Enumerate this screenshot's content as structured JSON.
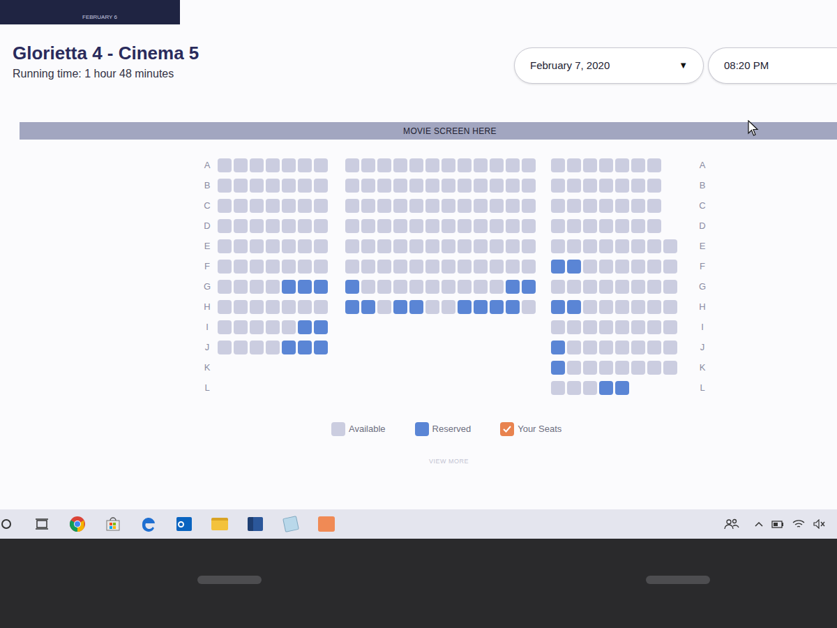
{
  "banner": {
    "text": "FEBRUARY 6"
  },
  "cinema": {
    "title": "Glorietta 4 - Cinema 5",
    "running_time": "Running time: 1 hour 48 minutes"
  },
  "date_select": {
    "value": "February 7, 2020",
    "arrow": "▼"
  },
  "time_select": {
    "value": "08:20 PM"
  },
  "screen_label": "MOVIE SCREEN HERE",
  "seat_map": {
    "rows": [
      {
        "label_left": "A",
        "label_right": "A",
        "left": [
          {
            "reserved": false
          },
          {
            "reserved": false
          },
          {
            "reserved": false
          },
          {
            "reserved": false
          },
          {
            "reserved": false
          },
          {
            "reserved": false
          },
          {
            "reserved": false
          }
        ],
        "middle": [
          {
            "reserved": false
          },
          {
            "reserved": false
          },
          {
            "reserved": false
          },
          {
            "reserved": false
          },
          {
            "reserved": false
          },
          {
            "reserved": false
          },
          {
            "reserved": false
          },
          {
            "reserved": false
          },
          {
            "reserved": false
          },
          {
            "reserved": false
          },
          {
            "reserved": false
          },
          {
            "reserved": false
          }
        ],
        "right": [
          {
            "reserved": false
          },
          {
            "reserved": false
          },
          {
            "reserved": false
          },
          {
            "reserved": false
          },
          {
            "reserved": false
          },
          {
            "reserved": false
          },
          {
            "reserved": false
          }
        ]
      },
      {
        "label_left": "B",
        "label_right": "B",
        "left": [
          {
            "reserved": false
          },
          {
            "reserved": false
          },
          {
            "reserved": false
          },
          {
            "reserved": false
          },
          {
            "reserved": false
          },
          {
            "reserved": false
          },
          {
            "reserved": false
          }
        ],
        "middle": [
          {
            "reserved": false
          },
          {
            "reserved": false
          },
          {
            "reserved": false
          },
          {
            "reserved": false
          },
          {
            "reserved": false
          },
          {
            "reserved": false
          },
          {
            "reserved": false
          },
          {
            "reserved": false
          },
          {
            "reserved": false
          },
          {
            "reserved": false
          },
          {
            "reserved": false
          },
          {
            "reserved": false
          }
        ],
        "right": [
          {
            "reserved": false
          },
          {
            "reserved": false
          },
          {
            "reserved": false
          },
          {
            "reserved": false
          },
          {
            "reserved": false
          },
          {
            "reserved": false
          },
          {
            "reserved": false
          }
        ]
      },
      {
        "label_left": "C",
        "label_right": "C",
        "left": [
          {
            "reserved": false
          },
          {
            "reserved": false
          },
          {
            "reserved": false
          },
          {
            "reserved": false
          },
          {
            "reserved": false
          },
          {
            "reserved": false
          },
          {
            "reserved": false
          }
        ],
        "middle": [
          {
            "reserved": false
          },
          {
            "reserved": false
          },
          {
            "reserved": false
          },
          {
            "reserved": false
          },
          {
            "reserved": false
          },
          {
            "reserved": false
          },
          {
            "reserved": false
          },
          {
            "reserved": false
          },
          {
            "reserved": false
          },
          {
            "reserved": false
          },
          {
            "reserved": false
          },
          {
            "reserved": false
          }
        ],
        "right": [
          {
            "reserved": false
          },
          {
            "reserved": false
          },
          {
            "reserved": false
          },
          {
            "reserved": false
          },
          {
            "reserved": false
          },
          {
            "reserved": false
          },
          {
            "reserved": false
          }
        ]
      },
      {
        "label_left": "D",
        "label_right": "D",
        "left": [
          {
            "reserved": false
          },
          {
            "reserved": false
          },
          {
            "reserved": false
          },
          {
            "reserved": false
          },
          {
            "reserved": false
          },
          {
            "reserved": false
          },
          {
            "reserved": false
          }
        ],
        "middle": [
          {
            "reserved": false
          },
          {
            "reserved": false
          },
          {
            "reserved": false
          },
          {
            "reserved": false
          },
          {
            "reserved": false
          },
          {
            "reserved": false
          },
          {
            "reserved": false
          },
          {
            "reserved": false
          },
          {
            "reserved": false
          },
          {
            "reserved": false
          },
          {
            "reserved": false
          },
          {
            "reserved": false
          }
        ],
        "right": [
          {
            "reserved": false
          },
          {
            "reserved": false
          },
          {
            "reserved": false
          },
          {
            "reserved": false
          },
          {
            "reserved": false
          },
          {
            "reserved": false
          },
          {
            "reserved": false
          }
        ]
      },
      {
        "label_left": "E",
        "label_right": "E",
        "left": [
          {
            "reserved": false
          },
          {
            "reserved": false
          },
          {
            "reserved": false
          },
          {
            "reserved": false
          },
          {
            "reserved": false
          },
          {
            "reserved": false
          },
          {
            "reserved": false
          }
        ],
        "middle": [
          {
            "reserved": false
          },
          {
            "reserved": false
          },
          {
            "reserved": false
          },
          {
            "reserved": false
          },
          {
            "reserved": false
          },
          {
            "reserved": false
          },
          {
            "reserved": false
          },
          {
            "reserved": false
          },
          {
            "reserved": false
          },
          {
            "reserved": false
          },
          {
            "reserved": false
          },
          {
            "reserved": false
          }
        ],
        "right": [
          {
            "reserved": false
          },
          {
            "reserved": false
          },
          {
            "reserved": false
          },
          {
            "reserved": false
          },
          {
            "reserved": false
          },
          {
            "reserved": false
          },
          {
            "reserved": false
          },
          {
            "reserved": false
          }
        ]
      },
      {
        "label_left": "F",
        "label_right": "F",
        "left": [
          {
            "reserved": false
          },
          {
            "reserved": false
          },
          {
            "reserved": false
          },
          {
            "reserved": false
          },
          {
            "reserved": false
          },
          {
            "reserved": false
          },
          {
            "reserved": false
          }
        ],
        "middle": [
          {
            "reserved": false
          },
          {
            "reserved": false
          },
          {
            "reserved": false
          },
          {
            "reserved": false
          },
          {
            "reserved": false
          },
          {
            "reserved": false
          },
          {
            "reserved": false
          },
          {
            "reserved": false
          },
          {
            "reserved": false
          },
          {
            "reserved": false
          },
          {
            "reserved": false
          },
          {
            "reserved": false
          }
        ],
        "right": [
          {
            "reserved": true
          },
          {
            "reserved": true
          },
          {
            "reserved": false
          },
          {
            "reserved": false
          },
          {
            "reserved": false
          },
          {
            "reserved": false
          },
          {
            "reserved": false
          },
          {
            "reserved": false
          }
        ]
      },
      {
        "label_left": "G",
        "label_right": "G",
        "left": [
          {
            "reserved": false
          },
          {
            "reserved": false
          },
          {
            "reserved": false
          },
          {
            "reserved": false
          },
          {
            "reserved": true
          },
          {
            "reserved": true
          },
          {
            "reserved": true
          }
        ],
        "middle": [
          {
            "reserved": true
          },
          {
            "reserved": false
          },
          {
            "reserved": false
          },
          {
            "reserved": false
          },
          {
            "reserved": false
          },
          {
            "reserved": false
          },
          {
            "reserved": false
          },
          {
            "reserved": false
          },
          {
            "reserved": false
          },
          {
            "reserved": false
          },
          {
            "reserved": true
          },
          {
            "reserved": true
          }
        ],
        "right": [
          {
            "reserved": false
          },
          {
            "reserved": false
          },
          {
            "reserved": false
          },
          {
            "reserved": false
          },
          {
            "reserved": false
          },
          {
            "reserved": false
          },
          {
            "reserved": false
          },
          {
            "reserved": false
          }
        ]
      },
      {
        "label_left": "H",
        "label_right": "H",
        "left": [
          {
            "reserved": false
          },
          {
            "reserved": false
          },
          {
            "reserved": false
          },
          {
            "reserved": false
          },
          {
            "reserved": false
          },
          {
            "reserved": false
          },
          {
            "reserved": false
          }
        ],
        "middle": [
          {
            "reserved": true
          },
          {
            "reserved": true
          },
          {
            "reserved": false
          },
          {
            "reserved": true
          },
          {
            "reserved": true
          },
          {
            "reserved": false
          },
          {
            "reserved": false
          },
          {
            "reserved": true
          },
          {
            "reserved": true
          },
          {
            "reserved": true
          },
          {
            "reserved": true
          },
          {
            "reserved": false
          }
        ],
        "right": [
          {
            "reserved": true
          },
          {
            "reserved": true
          },
          {
            "reserved": false
          },
          {
            "reserved": false
          },
          {
            "reserved": false
          },
          {
            "reserved": false
          },
          {
            "reserved": false
          },
          {
            "reserved": false
          }
        ]
      },
      {
        "label_left": "I",
        "label_right": "I",
        "left": [
          {
            "reserved": false
          },
          {
            "reserved": false
          },
          {
            "reserved": false
          },
          {
            "reserved": false
          },
          {
            "reserved": false
          },
          {
            "reserved": true
          },
          {
            "reserved": true
          }
        ],
        "middle": [],
        "right": [
          {
            "reserved": false
          },
          {
            "reserved": false
          },
          {
            "reserved": false
          },
          {
            "reserved": false
          },
          {
            "reserved": false
          },
          {
            "reserved": false
          },
          {
            "reserved": false
          },
          {
            "reserved": false
          }
        ]
      },
      {
        "label_left": "J",
        "label_right": "J",
        "left": [
          {
            "reserved": false
          },
          {
            "reserved": false
          },
          {
            "reserved": false
          },
          {
            "reserved": false
          },
          {
            "reserved": true
          },
          {
            "reserved": true
          },
          {
            "reserved": true
          }
        ],
        "middle": [],
        "right": [
          {
            "reserved": true
          },
          {
            "reserved": false
          },
          {
            "reserved": false
          },
          {
            "reserved": false
          },
          {
            "reserved": false
          },
          {
            "reserved": false
          },
          {
            "reserved": false
          },
          {
            "reserved": false
          }
        ]
      },
      {
        "label_left": "K",
        "label_right": "K",
        "left": [],
        "middle": [],
        "right": [
          {
            "reserved": true
          },
          {
            "reserved": false
          },
          {
            "reserved": false
          },
          {
            "reserved": false
          },
          {
            "reserved": false
          },
          {
            "reserved": false
          },
          {
            "reserved": false
          },
          {
            "reserved": false
          }
        ]
      },
      {
        "label_left": "L",
        "label_right": "L",
        "left": [],
        "middle": [],
        "right": [
          {
            "reserved": false
          },
          {
            "reserved": false
          },
          {
            "reserved": false
          },
          {
            "reserved": true
          },
          {
            "reserved": true
          }
        ]
      }
    ]
  },
  "legend": {
    "items": [
      {
        "label": "Available",
        "kind": "available"
      },
      {
        "label": "Reserved",
        "kind": "reserved"
      },
      {
        "label": "Your Seats",
        "kind": "yours"
      }
    ]
  },
  "view_more": "VIEW MORE"
}
